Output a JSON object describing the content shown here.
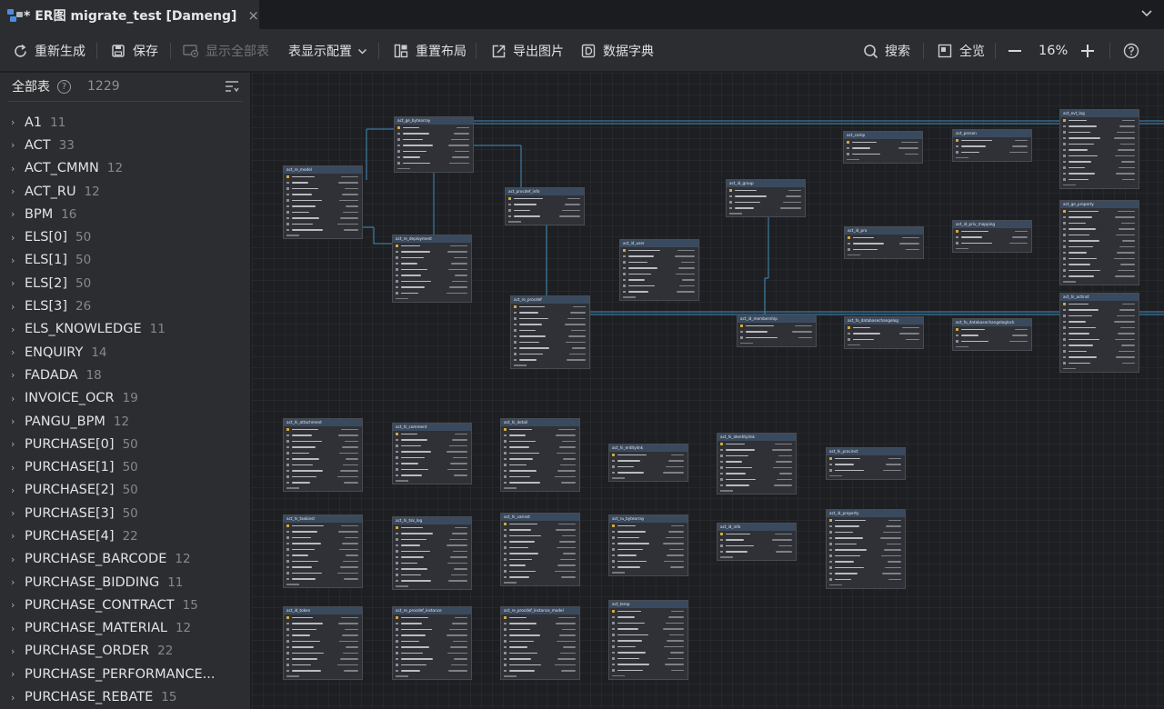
{
  "tab": {
    "title": "* ER图 migrate_test [Dameng]",
    "close": "×"
  },
  "toolbar": {
    "regenerate": "重新生成",
    "save": "保存",
    "show_all": "显示全部表",
    "table_config": "表显示配置",
    "relayout": "重置布局",
    "export_image": "导出图片",
    "data_dict": "数据字典",
    "search": "搜索",
    "full_view": "全览",
    "zoom": "16%"
  },
  "sidebar": {
    "title": "全部表",
    "count": "1229",
    "items": [
      {
        "name": "A1",
        "count": "11"
      },
      {
        "name": "ACT",
        "count": "33"
      },
      {
        "name": "ACT_CMMN",
        "count": "12"
      },
      {
        "name": "ACT_RU",
        "count": "12"
      },
      {
        "name": "BPM",
        "count": "16"
      },
      {
        "name": "ELS[0]",
        "count": "50"
      },
      {
        "name": "ELS[1]",
        "count": "50"
      },
      {
        "name": "ELS[2]",
        "count": "50"
      },
      {
        "name": "ELS[3]",
        "count": "26"
      },
      {
        "name": "ELS_KNOWLEDGE",
        "count": "11"
      },
      {
        "name": "ENQUIRY",
        "count": "14"
      },
      {
        "name": "FADADA",
        "count": "18"
      },
      {
        "name": "INVOICE_OCR",
        "count": "19"
      },
      {
        "name": "PANGU_BPM",
        "count": "12"
      },
      {
        "name": "PURCHASE[0]",
        "count": "50"
      },
      {
        "name": "PURCHASE[1]",
        "count": "50"
      },
      {
        "name": "PURCHASE[2]",
        "count": "50"
      },
      {
        "name": "PURCHASE[3]",
        "count": "50"
      },
      {
        "name": "PURCHASE[4]",
        "count": "22"
      },
      {
        "name": "PURCHASE_BARCODE",
        "count": "12"
      },
      {
        "name": "PURCHASE_BIDDING",
        "count": "11"
      },
      {
        "name": "PURCHASE_CONTRACT",
        "count": "15"
      },
      {
        "name": "PURCHASE_MATERIAL",
        "count": "12"
      },
      {
        "name": "PURCHASE_ORDER",
        "count": "22"
      },
      {
        "name": "PURCHASE_PERFORMANCE...",
        "count": ""
      },
      {
        "name": "PURCHASE_REBATE",
        "count": "15"
      }
    ]
  },
  "tables": [
    {
      "name": "act_ge_bytearray"
    },
    {
      "name": "act_re_model"
    },
    {
      "name": "act_procdef_info"
    },
    {
      "name": "act_re_deployment"
    },
    {
      "name": "act_re_procdef"
    },
    {
      "name": "act_id_user"
    },
    {
      "name": "act_id_group"
    },
    {
      "name": "act_id_membership"
    },
    {
      "name": "act_evt_log"
    },
    {
      "name": "act_comp"
    },
    {
      "name": "act_person"
    },
    {
      "name": "act_id_pro"
    },
    {
      "name": "act_id_priv_mapping"
    },
    {
      "name": "act_fo_databasechangelog"
    },
    {
      "name": "act_fo_databasechangeloglock"
    },
    {
      "name": "act_ge_property"
    },
    {
      "name": "act_hi_actinst"
    },
    {
      "name": "act_hi_attachment"
    },
    {
      "name": "act_hi_comment"
    },
    {
      "name": "act_hi_detail"
    },
    {
      "name": "act_hi_entitylink"
    },
    {
      "name": "act_hi_identitylink"
    },
    {
      "name": "act_hi_procinst"
    },
    {
      "name": "act_hi_taskinst"
    },
    {
      "name": "act_hi_tsk_log"
    },
    {
      "name": "act_hi_varinst"
    },
    {
      "name": "act_ru_bytearray"
    },
    {
      "name": "act_id_info"
    },
    {
      "name": "act_id_property"
    },
    {
      "name": "act_id_token"
    },
    {
      "name": "act_re_procdef_instance"
    },
    {
      "name": "act_re_procdef_instance_model"
    },
    {
      "name": "act_temp"
    }
  ]
}
